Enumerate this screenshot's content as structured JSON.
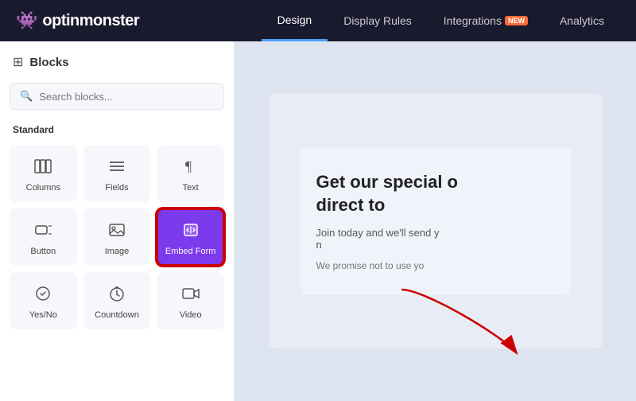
{
  "header": {
    "logo_text": "optinmonster",
    "logo_monster_emoji": "👾",
    "tabs": [
      {
        "id": "design",
        "label": "Design",
        "active": true
      },
      {
        "id": "display-rules",
        "label": "Display Rules",
        "active": false
      },
      {
        "id": "integrations",
        "label": "Integrations",
        "active": false,
        "badge": "NEW"
      },
      {
        "id": "analytics",
        "label": "Analytics",
        "active": false
      }
    ]
  },
  "sidebar": {
    "title": "Blocks",
    "search_placeholder": "Search blocks...",
    "section_label": "Standard",
    "blocks": [
      {
        "id": "columns",
        "label": "Columns",
        "icon": "⊞"
      },
      {
        "id": "fields",
        "label": "Fields",
        "icon": "≡"
      },
      {
        "id": "text",
        "label": "Text",
        "icon": "¶"
      },
      {
        "id": "button",
        "label": "Button",
        "icon": "⊡"
      },
      {
        "id": "image",
        "label": "Image",
        "icon": "🖼"
      },
      {
        "id": "embed-form",
        "label": "Embed Form",
        "icon": "{ }",
        "selected": true
      },
      {
        "id": "yes-no",
        "label": "Yes/No",
        "icon": "⊙"
      },
      {
        "id": "countdown",
        "label": "Countdown",
        "icon": "⏰"
      },
      {
        "id": "video",
        "label": "Video",
        "icon": "🎬"
      }
    ]
  },
  "canvas": {
    "heading": "Get our special o",
    "heading2": "direct to",
    "subtext": "Join today and we'll send y",
    "subtext2": "n",
    "footer": "We promise not to use yo"
  }
}
